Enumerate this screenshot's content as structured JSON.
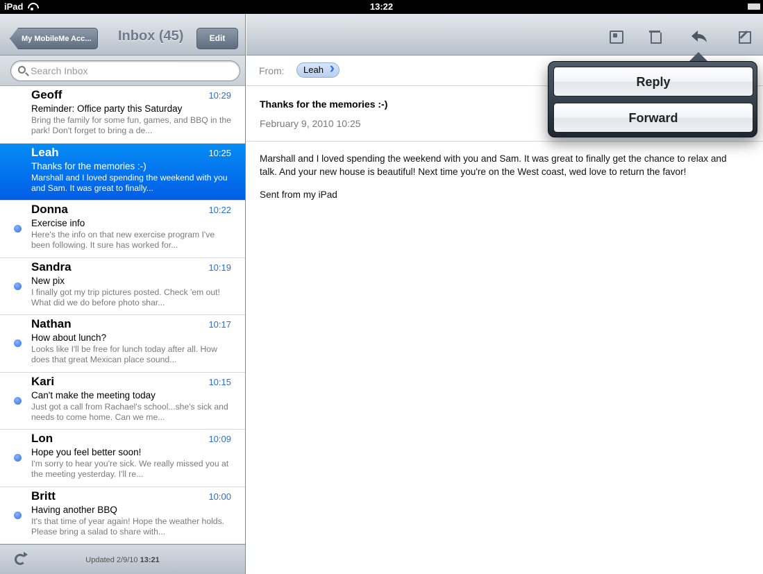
{
  "status_bar": {
    "device": "iPad",
    "time": "13:22"
  },
  "left_nav": {
    "back_label": "My MobileMe Acc...",
    "title": "Inbox (45)",
    "edit_label": "Edit"
  },
  "search": {
    "placeholder": "Search Inbox"
  },
  "messages": [
    {
      "sender": "Geoff",
      "time": "10:29",
      "subject": "Reminder: Office party this Saturday",
      "preview": "Bring the family for some fun, games, and BBQ in the park! Don't forget to bring a de...",
      "unread": false,
      "selected": false
    },
    {
      "sender": "Leah",
      "time": "10:25",
      "subject": "Thanks for the memories :-)",
      "preview": "Marshall and I loved spending the weekend with you and Sam. It was great to finally...",
      "unread": false,
      "selected": true
    },
    {
      "sender": "Donna",
      "time": "10:22",
      "subject": "Exercise info",
      "preview": "Here's the info on that new exercise program I've been following. It sure has worked for...",
      "unread": true,
      "selected": false
    },
    {
      "sender": "Sandra",
      "time": "10:19",
      "subject": "New pix",
      "preview": "I finally got my trip pictures posted. Check 'em out! What did we do before photo shar...",
      "unread": true,
      "selected": false
    },
    {
      "sender": "Nathan",
      "time": "10:17",
      "subject": "How about lunch?",
      "preview": "Looks like I'll be free for lunch today after all. How does that great Mexican place sound...",
      "unread": true,
      "selected": false
    },
    {
      "sender": "Kari",
      "time": "10:15",
      "subject": "Can't make the meeting today",
      "preview": "Just got a call from Rachael's school...she's sick and needs to come home. Can we me...",
      "unread": true,
      "selected": false
    },
    {
      "sender": "Lon",
      "time": "10:09",
      "subject": "Hope you feel better soon!",
      "preview": "I'm sorry to hear you're sick. We really missed you at the meeting yesterday. I'll re...",
      "unread": true,
      "selected": false
    },
    {
      "sender": "Britt",
      "time": "10:00",
      "subject": "Having another BBQ",
      "preview": "It's that time of year again! Hope the weather holds. Please bring a salad to share with...",
      "unread": true,
      "selected": false
    }
  ],
  "bottom_toolbar": {
    "updated_label": "Updated",
    "updated_date": "2/9/10",
    "updated_time": "13:21"
  },
  "toolbar_icons": [
    "folder-move-icon",
    "trash-icon",
    "reply-icon",
    "compose-icon"
  ],
  "message": {
    "from_label": "From:",
    "from_name": "Leah",
    "subject": "Thanks for the memories :-)",
    "date": "February 9, 2010 10:25",
    "body": [
      "Marshall and I loved spending the weekend with you and Sam. It was great to finally get the chance to relax and talk. And your new house is beautiful! Next time you're on the West coast, wed love to return the favor!",
      "Sent from my iPad"
    ]
  },
  "popover": {
    "reply_label": "Reply",
    "forward_label": "Forward"
  },
  "colors": {
    "selected_row": "#0a6cf0",
    "time_blue": "#2a6fd6",
    "unread_dot": "#2f6fe0"
  }
}
